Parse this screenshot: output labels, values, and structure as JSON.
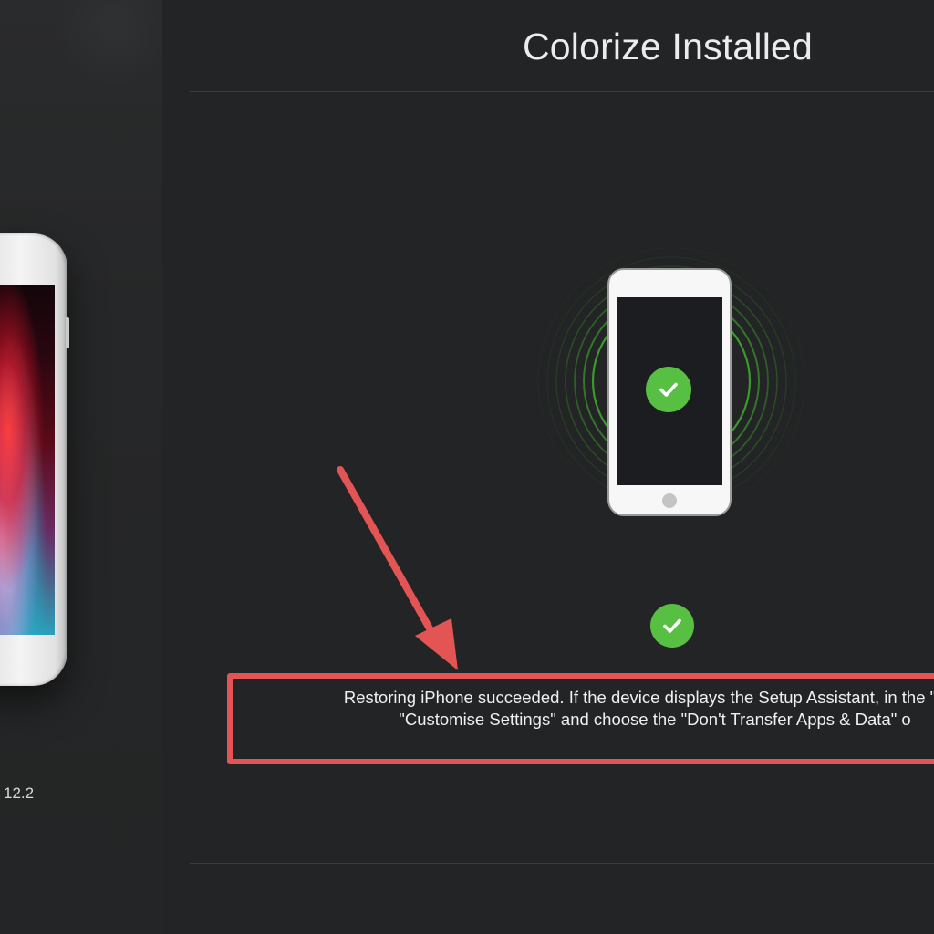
{
  "window": {
    "title": "Colorize Installed"
  },
  "sidebar": {
    "device_version": "12.2",
    "device_icon": "iphone-photo"
  },
  "main": {
    "device_status_icon": "check-circle-icon",
    "status_icon": "check-circle-icon",
    "status_message": {
      "line1": "Restoring iPhone succeeded. If the device displays the Setup Assistant, in the \"App",
      "line2": "\"Customise Settings\" and choose the \"Don't Transfer Apps & Data\" o"
    }
  },
  "colors": {
    "background": "#232425",
    "sidebar": "#262728",
    "success_green": "#57c043",
    "annotation_red": "#e35555",
    "signal_green": "#3fae2f"
  }
}
